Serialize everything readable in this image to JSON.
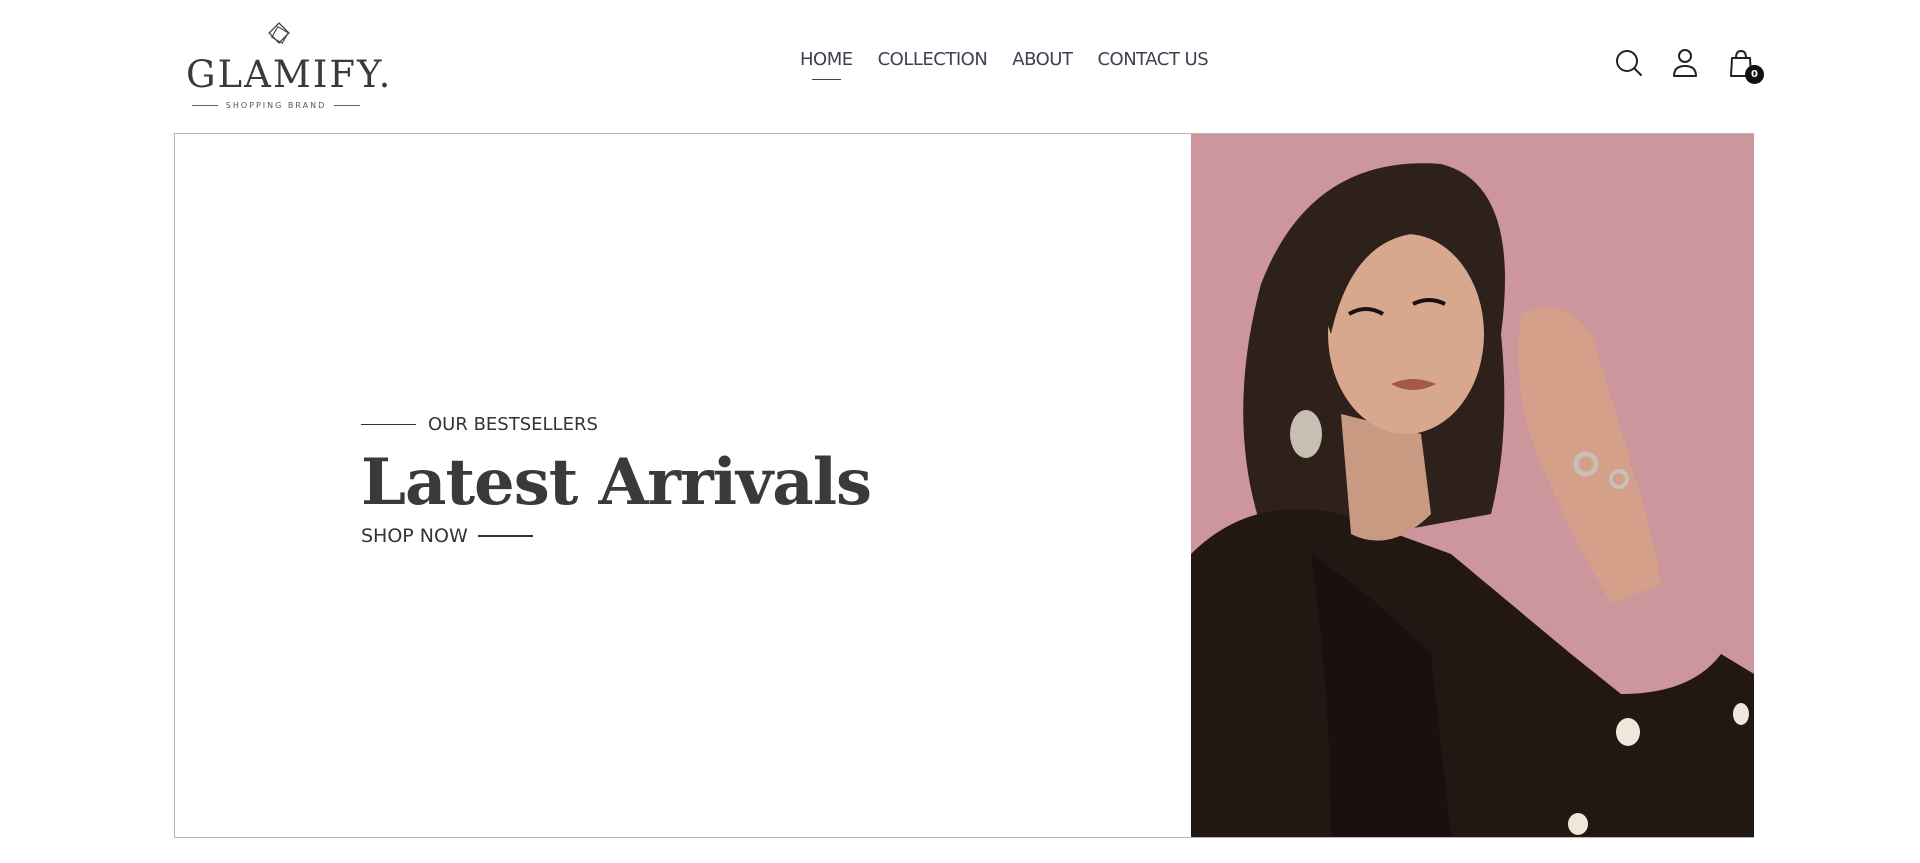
{
  "brand": {
    "name": "GLAMIFY.",
    "tagline": "SHOPPING BRAND"
  },
  "nav": {
    "items": [
      {
        "label": "HOME",
        "active": true
      },
      {
        "label": "COLLECTION",
        "active": false
      },
      {
        "label": "ABOUT",
        "active": false
      },
      {
        "label": "CONTACT US",
        "active": false
      }
    ]
  },
  "header_icons": [
    "search-icon",
    "account-icon",
    "cart-icon"
  ],
  "cart": {
    "count": "0"
  },
  "hero": {
    "eyebrow": "OUR BESTSELLERS",
    "headline": "Latest Arrivals",
    "cta": "SHOP NOW",
    "image_background": "#cd959c"
  },
  "colors": {
    "text": "#333333",
    "nav": "#3d4252",
    "border": "#b5b5b5"
  }
}
